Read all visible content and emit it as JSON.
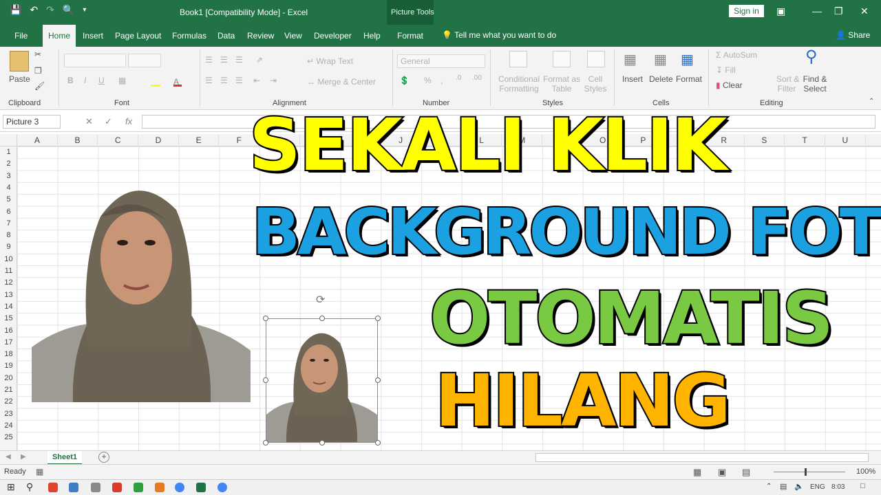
{
  "titlebar": {
    "title": "Book1  [Compatibility Mode]  -  Excel",
    "context_label": "Picture Tools",
    "signin": "Sign in",
    "qat": {
      "save_icon": "save-icon",
      "undo_icon": "undo-icon",
      "redo_icon": "redo-icon",
      "preview_icon": "print-preview-icon"
    }
  },
  "tabs": [
    "File",
    "Home",
    "Insert",
    "Page Layout",
    "Formulas",
    "Data",
    "Review",
    "View",
    "Developer",
    "Help",
    "Format"
  ],
  "tellme": "Tell me what you want to do",
  "share": "Share",
  "ribbon": {
    "clipboard": {
      "paste": "Paste",
      "label": "Clipboard"
    },
    "font": {
      "label": "Font",
      "bold": "B",
      "italic": "I",
      "underline": "U"
    },
    "alignment": {
      "wrap": "Wrap Text",
      "merge": "Merge & Center",
      "label": "Alignment"
    },
    "number": {
      "format": "General",
      "label": "Number"
    },
    "styles": {
      "conditional_1": "Conditional",
      "conditional_2": "Formatting",
      "format_as_1": "Format as",
      "format_as_2": "Table",
      "cell_1": "Cell",
      "cell_2": "Styles",
      "label": "Styles"
    },
    "cells": {
      "insert": "Insert",
      "delete": "Delete",
      "format": "Format",
      "label": "Cells"
    },
    "editing": {
      "autosum": "AutoSum",
      "fill": "Fill",
      "clear": "Clear",
      "sort_1": "Sort &",
      "sort_2": "Filter",
      "find_1": "Find &",
      "find_2": "Select",
      "label": "Editing"
    }
  },
  "formula_bar": {
    "name_box": "Picture 3",
    "fx": "fx",
    "value": ""
  },
  "grid": {
    "columns": [
      "A",
      "B",
      "C",
      "D",
      "E",
      "F",
      "G",
      "H",
      "I",
      "J",
      "K",
      "L",
      "M",
      "N",
      "O",
      "P",
      "Q",
      "R",
      "S",
      "T",
      "U"
    ],
    "rows": [
      "1",
      "2",
      "3",
      "4",
      "5",
      "6",
      "7",
      "8",
      "9",
      "10",
      "11",
      "12",
      "13",
      "14",
      "15",
      "16",
      "17",
      "18",
      "19",
      "20",
      "21",
      "22",
      "23",
      "24",
      "25"
    ]
  },
  "overlay": {
    "line1": "SEKALI KLIK",
    "line2": "BACKGROUND FOTO",
    "line3": "OTOMATIS",
    "line4": "HILANG",
    "colors": {
      "yellow": "#ffff00",
      "blue": "#1ba1e2",
      "green": "#7ac943",
      "orange": "#ffb400",
      "outline": "#000000"
    }
  },
  "sheets": {
    "active": "Sheet1",
    "add": "+"
  },
  "status": {
    "ready": "Ready",
    "zoom": "100%"
  },
  "taskbar": {
    "lang": "ENG",
    "time": "8:03"
  }
}
